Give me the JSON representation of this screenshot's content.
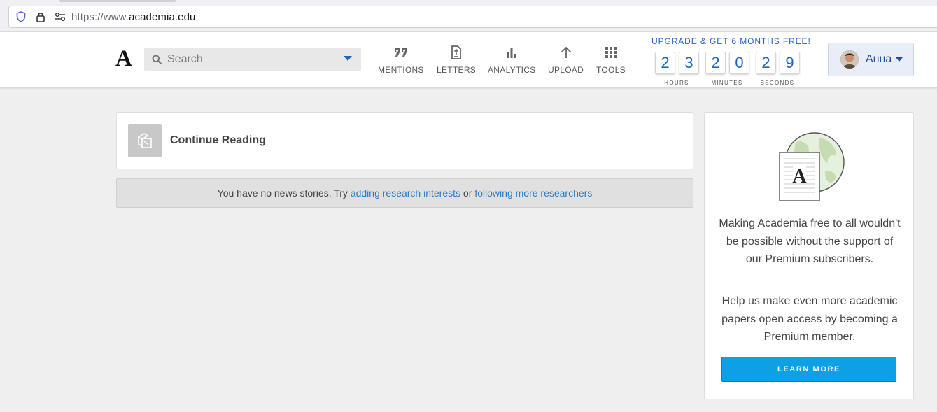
{
  "browser": {
    "url_prefix": "https://www.",
    "url_domain": "academia.edu"
  },
  "header": {
    "logo": "A",
    "search_placeholder": "Search",
    "nav": [
      {
        "label": "MENTIONS",
        "icon": "quote-icon"
      },
      {
        "label": "LETTERS",
        "icon": "document-icon"
      },
      {
        "label": "ANALYTICS",
        "icon": "bar-chart-icon"
      },
      {
        "label": "UPLOAD",
        "icon": "arrow-up-icon"
      },
      {
        "label": "TOOLS",
        "icon": "grid-icon"
      }
    ],
    "upgrade": {
      "title": "UPGRADE & GET 6 MONTHS FREE!",
      "digits": [
        "2",
        "3",
        "2",
        "0",
        "2",
        "9"
      ],
      "units": [
        "HOURS",
        "MINUTES",
        "SECONDS"
      ]
    },
    "user": {
      "name": "Анна"
    }
  },
  "main": {
    "continue_reading": "Continue Reading",
    "news": {
      "text_before": "You have no news stories. Try ",
      "link1": "adding research interests",
      "text_mid": " or ",
      "link2": "following more researchers"
    }
  },
  "promo": {
    "illustration_letter": "A",
    "paragraph1": "Making Academia free to all wouldn't be possible without the support of our Premium subscribers.",
    "paragraph2": "Help us make even more academic papers open access by becoming a Premium member.",
    "button": "LEARN MORE"
  },
  "colors": {
    "accent_blue": "#1f63c5",
    "button_blue": "#0da0e6",
    "link_blue": "#2c7bc7"
  }
}
